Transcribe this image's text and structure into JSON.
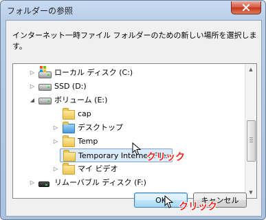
{
  "dialog": {
    "title": "フォルダーの参照",
    "instruction": "インターネット一時ファイル フォルダーのための新しい場所を選択します。"
  },
  "tree": {
    "items": [
      {
        "label": "ローカル ディスク (C:)",
        "icon": "system-drive-icon",
        "expander": "▷"
      },
      {
        "label": "SSD (D:)",
        "icon": "drive-icon",
        "expander": "▷"
      },
      {
        "label": "ボリューム (E:)",
        "icon": "drive-icon",
        "expander": "◢"
      },
      {
        "label": "cap",
        "icon": "folder-icon",
        "expander": ""
      },
      {
        "label": "デスクトップ",
        "icon": "folder-icon",
        "expander": "▷"
      },
      {
        "label": "Temp",
        "icon": "folder-icon",
        "expander": "▷"
      },
      {
        "label": "Temporary Internet Files",
        "icon": "folder-icon",
        "expander": "",
        "selected": true
      },
      {
        "label": "マイ ビデオ",
        "icon": "folder-icon",
        "expander": "▷"
      },
      {
        "label": "リムーバブル ディスク (F:)",
        "icon": "removable-drive-icon",
        "expander": "▷"
      }
    ]
  },
  "buttons": {
    "ok": "OK",
    "cancel": "キャンセル"
  },
  "annotations": {
    "tree_click": "クリック",
    "ok_click": "クリック"
  },
  "colors": {
    "annotation": "#ff1f1f",
    "selection_bg": "#dcebfc",
    "selection_border": "#7da2ce"
  }
}
